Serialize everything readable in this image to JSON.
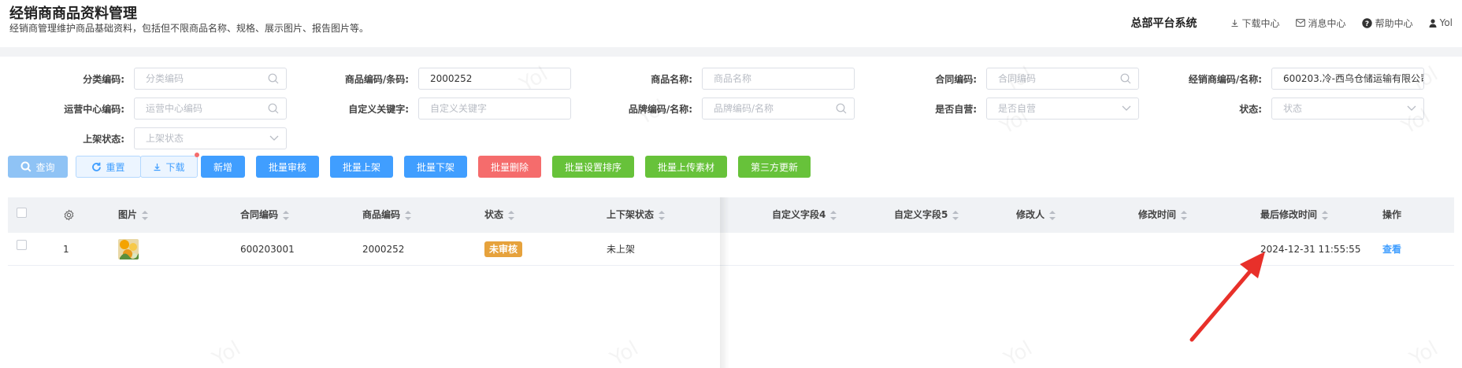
{
  "header": {
    "title": "经销商商品资料管理",
    "subtitle": "经销商管理维护商品基础资料，包括但不限商品名称、规格、展示图片、报告图片等。",
    "brand": "总部平台系统",
    "download_center": "下载中心",
    "message_center": "消息中心",
    "help_center": "帮助中心",
    "user": "Yol"
  },
  "filters": {
    "category_code": {
      "label": "分类编码:",
      "placeholder": "分类编码",
      "value": ""
    },
    "product_code": {
      "label": "商品编码/条码:",
      "placeholder": "",
      "value": "2000252"
    },
    "product_name": {
      "label": "商品名称:",
      "placeholder": "商品名称",
      "value": ""
    },
    "contract_code": {
      "label": "合同编码:",
      "placeholder": "合同编码",
      "value": ""
    },
    "dealer": {
      "label": "经销商编码/名称:",
      "placeholder": "",
      "value": "600203.冷-西乌仓储运输有限公司"
    },
    "ops_center": {
      "label": "运营中心编码:",
      "placeholder": "运营中心编码",
      "value": ""
    },
    "custom_keyword": {
      "label": "自定义关键字:",
      "placeholder": "自定义关键字",
      "value": ""
    },
    "brand": {
      "label": "品牌编码/名称:",
      "placeholder": "品牌编码/名称",
      "value": ""
    },
    "self_operated": {
      "label": "是否自营:",
      "placeholder": "是否自营",
      "value": ""
    },
    "status": {
      "label": "状态:",
      "placeholder": "状态",
      "value": ""
    },
    "shelf_status": {
      "label": "上架状态:",
      "placeholder": "上架状态",
      "value": ""
    }
  },
  "toolbar": {
    "query": "查询",
    "reset": "重置",
    "download": "下载",
    "add": "新增",
    "batch_review": "批量审核",
    "batch_on_shelf": "批量上架",
    "batch_off_shelf": "批量下架",
    "batch_delete": "批量删除",
    "batch_sort": "批量设置排序",
    "batch_upload": "批量上传素材",
    "third_party_update": "第三方更新"
  },
  "table": {
    "headers": {
      "image": "图片",
      "contract_code": "合同编码",
      "product_code": "商品编码",
      "status": "状态",
      "shelf_status": "上下架状态",
      "custom4": "自定义字段4",
      "custom5": "自定义字段5",
      "modifier": "修改人",
      "modify_time": "修改时间",
      "last_modify_time": "最后修改时间",
      "action": "操作"
    },
    "rows": [
      {
        "index": "1",
        "contract_code": "600203001",
        "product_code": "2000252",
        "status": "未审核",
        "shelf_status": "未上架",
        "last_modify_time": "2024-12-31 11:55:55",
        "action": "查看"
      }
    ]
  },
  "watermark": "Yol",
  "colors": {
    "primary": "#409eff",
    "danger": "#f56c6c",
    "success": "#67c23a",
    "warning": "#e6a23c",
    "annotation_arrow": "#e8302a"
  }
}
